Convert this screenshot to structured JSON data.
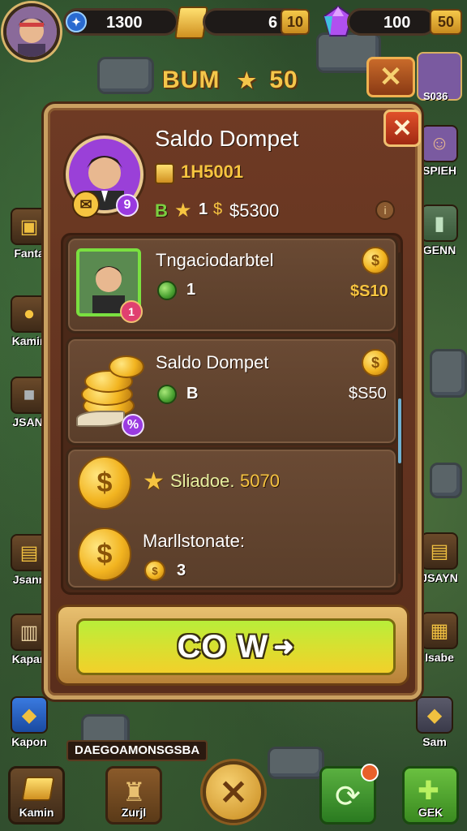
{
  "hud": {
    "energy_value": "1300",
    "gold_value": "6",
    "gold_plus": "10",
    "gems_value": "100",
    "gems_plus": "50",
    "bonus_title": "BUM",
    "bonus_value": "50",
    "reward_label": "S036"
  },
  "left_sidebar": [
    {
      "label": "Fanta"
    },
    {
      "label": "Kamin"
    },
    {
      "label": "JSANI"
    },
    {
      "label": "Jsann"
    },
    {
      "label": "Kapan"
    },
    {
      "label": "Kapon"
    }
  ],
  "right_sidebar": [
    {
      "label": "SPIEH"
    },
    {
      "label": "GENN"
    },
    {
      "label": "JSAYN"
    },
    {
      "label": "Isabe"
    },
    {
      "label": "Sam"
    }
  ],
  "dialog": {
    "title": "Saldo Dompet",
    "balance_value": "1H5001",
    "rank_letter": "B",
    "stars_count": "1",
    "stars_price": "$5300",
    "items": [
      {
        "title": "Tngaciodarbtel",
        "qty": "1",
        "price": "$S10",
        "badge": "1"
      },
      {
        "title": "Saldo Dompet",
        "qty": "B",
        "price": "$S50",
        "badge": "%"
      }
    ],
    "summary": {
      "line1_label": "Sliadoe.",
      "line1_value": "5070",
      "line2_label": "Marllstonate:",
      "line2_qty": "3"
    },
    "confirm_label": "CO W"
  },
  "footer": {
    "banner_text": "DAEGOAMONSGSBA",
    "buttons": [
      {
        "label": "Kamin"
      },
      {
        "label": "Zurjl"
      },
      {
        "label": ""
      },
      {
        "label": ""
      },
      {
        "label": "GEK"
      }
    ]
  },
  "colors": {
    "panel": "#6e3a24",
    "panel_border": "#c9a061",
    "accent_gold": "#f6c440",
    "confirm_green": "#b8ee3a",
    "close_red": "#e0502a",
    "gem_purple": "#9a3ae0"
  }
}
